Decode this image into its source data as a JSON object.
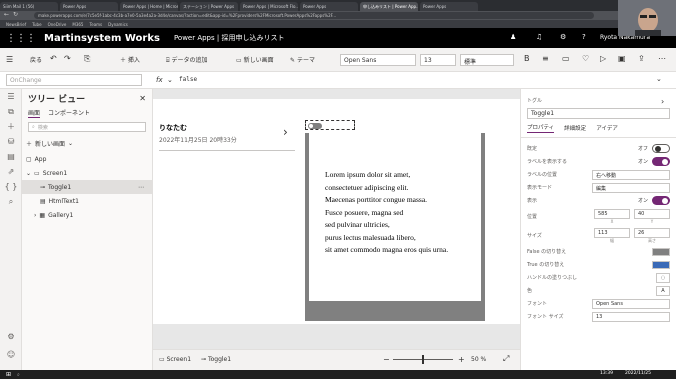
{
  "browser": {
    "tabs": [
      "Siim Mail 1 (56)",
      "Power Apps",
      "Power Apps | Home | Microsoft",
      "ステーション | Power Apps",
      "Power Apps | Microsoft Flo...",
      "Power Apps",
      "申し込みリスト | Power App...",
      "Power Apps"
    ],
    "address": "make.powerapps.com/e/7c5e5f-1abc-4c3b-a7e0-5a3e4a2a-3d4e/canvas/?action=edit&app-id=%2Fproviders%2FMicrosoft.PowerApps%2Fapps%2F...",
    "bookmarks": [
      "NewsBrief",
      "Tube",
      "OneDrive",
      "M365",
      "Teams",
      "Dynamics"
    ]
  },
  "header": {
    "brand": "Martinsystem Works",
    "app_title": "Power Apps | 採用申し込みリスト",
    "user": "Ryota Nakamura"
  },
  "command": {
    "back": "戻る",
    "insert": "挿入",
    "add_data": "データの追加",
    "new_screen": "新しい画面",
    "theme": "テーマ",
    "font": "Open Sans",
    "size": "13",
    "weight": "標準"
  },
  "formula": {
    "property": "OnChange",
    "fx": "fx",
    "value": "false"
  },
  "tree": {
    "title": "ツリー ビュー",
    "tab_screens": "画面",
    "tab_components": "コンポーネント",
    "search_placeholder": "検索",
    "new_screen": "新しい画面",
    "items": [
      "App",
      "Screen1",
      "Toggle1",
      "HtmlText1",
      "Gallery1"
    ]
  },
  "canvas": {
    "gallery_title": "りなたむ",
    "gallery_date": "2022年11月25日 20時33分",
    "html_text": [
      "Lorem ipsum dolor sit amet,",
      "consectetuer adipiscing elit.",
      "Maecenas porttitor congue massa.",
      "Fusce posuere, magna sed",
      "sed pulvinar ultricies,",
      "purus lectus malesuada libero,",
      "sit amet commodo magna eros quis urna."
    ]
  },
  "status": {
    "screen": "Screen1",
    "toggle": "Toggle1",
    "zoom_value": 0.5,
    "zoom_label": "50 %"
  },
  "props": {
    "type": "トグル",
    "name": "Toggle1",
    "tabs": [
      "プロパティ",
      "詳細設定",
      "アイデア"
    ],
    "rows": [
      {
        "label": "既定",
        "value": "オフ",
        "kind": "toggle-off"
      },
      {
        "label": "ラベルを表示する",
        "value": "オン",
        "kind": "toggle-on"
      },
      {
        "label": "ラベルの位置",
        "value": "右へ移動",
        "kind": "select"
      },
      {
        "label": "表示モード",
        "value": "編集",
        "kind": "select"
      },
      {
        "label": "表示",
        "value": "オン",
        "kind": "toggle-on"
      },
      {
        "label": "位置",
        "x": "585",
        "y": "40",
        "xl": "X",
        "yl": "Y",
        "kind": "pair"
      },
      {
        "label": "サイズ",
        "x": "113",
        "y": "26",
        "xl": "幅",
        "yl": "高さ",
        "kind": "pair"
      },
      {
        "label": "False の切り替え",
        "value": "#808080",
        "kind": "color"
      },
      {
        "label": "True の切り替え",
        "value": "#3a6ab7",
        "kind": "color"
      },
      {
        "label": "ハンドルの塗りつぶし",
        "value": "#ffffff",
        "kind": "iconbox"
      },
      {
        "label": "色",
        "value": "A",
        "kind": "iconbox"
      },
      {
        "label": "フォント",
        "value": "Open Sans",
        "kind": "select"
      },
      {
        "label": "フォント サイズ",
        "value": "13",
        "kind": "input"
      }
    ]
  },
  "taskbar": {
    "time": "13:39",
    "date": "2022/11/25"
  },
  "colors": {
    "accent": "#742774",
    "toggle_off": "#808080",
    "toggle_on": "#3a6ab7"
  }
}
